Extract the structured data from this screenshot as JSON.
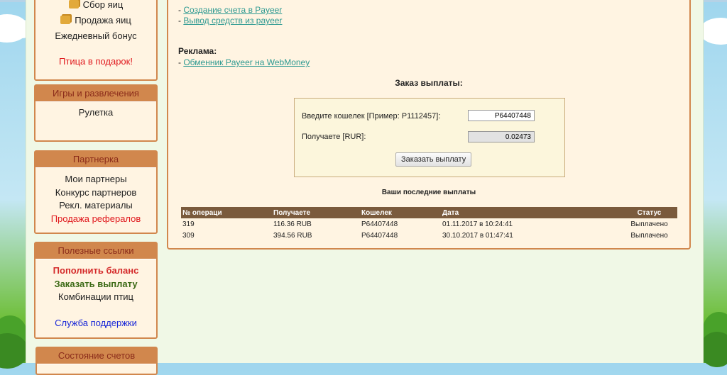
{
  "sidebar": {
    "top_box": {
      "items": [
        {
          "label": "Сбор яиц",
          "icon": "egg-icon"
        },
        {
          "label": "Продажа яиц",
          "icon": "coin-icon"
        },
        {
          "label": "Ежедневный бонус"
        },
        {
          "label": ""
        },
        {
          "label": "Птица в подарок!"
        }
      ]
    },
    "games": {
      "header": "Игры и развлечения",
      "items": [
        "Рулетка"
      ]
    },
    "partners": {
      "header": "Партнерка",
      "items": [
        "Мои партнеры",
        "Конкурс партнеров",
        "Рекл. материалы",
        "Продажа рефералов"
      ]
    },
    "useful": {
      "header": "Полезные ссылки",
      "items": [
        "Пополнить баланс",
        "Заказать выплату",
        "Комбинации птиц",
        "",
        "Служба поддержки"
      ]
    },
    "accounts": {
      "header": "Состояние счетов"
    }
  },
  "main": {
    "links": [
      {
        "prefix": "- ",
        "label": "Создание счета в Payeer"
      },
      {
        "prefix": "- ",
        "label": "Вывод средств из payeer"
      }
    ],
    "ad": {
      "title": "Реклама:",
      "prefix": "- ",
      "link": "Обменник Payeer на WebMoney"
    },
    "order_title": "Заказ выплаты:",
    "form": {
      "wallet_label": "Введите кошелек [Пример: P1112457]:",
      "wallet_value": "P64407448",
      "receive_label": "Получаете [RUR]:",
      "receive_value": "0.02473",
      "submit_label": "Заказать выплату"
    },
    "payments": {
      "title": "Ваши последние выплаты",
      "columns": [
        "№ операци",
        "Получаете",
        "Кошелек",
        "Дата",
        "Статус"
      ],
      "rows": [
        [
          "319",
          "116.36 RUB",
          "P64407448",
          "01.11.2017 в 10:24:41",
          "Выплачено"
        ],
        [
          "309",
          "394.56 RUB",
          "P64407448",
          "30.10.2017 в 01:47:41",
          "Выплачено"
        ]
      ]
    }
  }
}
